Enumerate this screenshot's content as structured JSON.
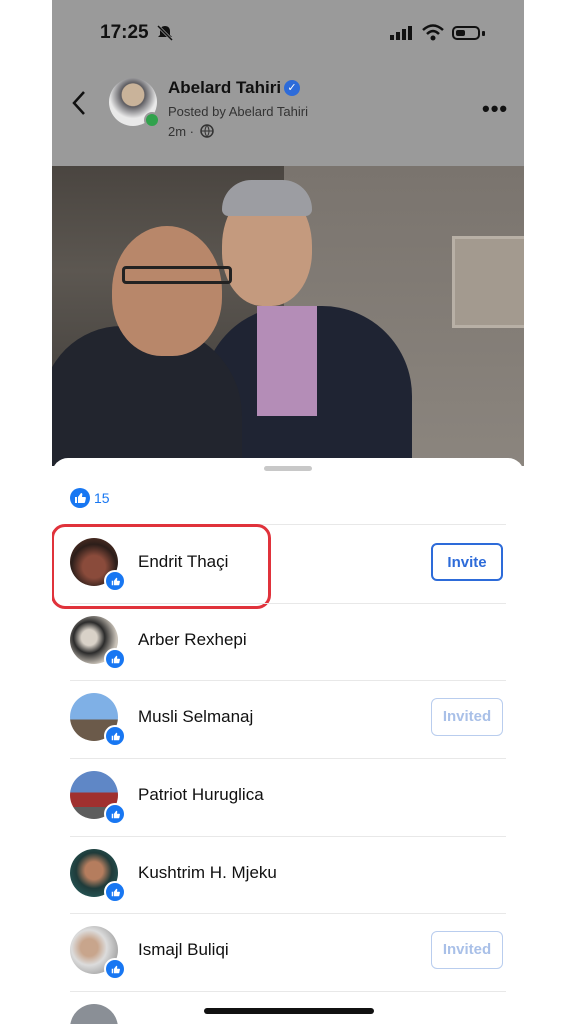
{
  "status_bar": {
    "time": "17:25"
  },
  "post_header": {
    "author": "Abelard Tahiri",
    "posted_by": "Posted by Abelard Tahiri",
    "age": "2m ·"
  },
  "reactions": {
    "count": "15",
    "rows": [
      {
        "name": "Endrit Thaçi",
        "action": "Invite",
        "state": "invite",
        "highlighted": true
      },
      {
        "name": "Arber Rexhepi",
        "action": "",
        "state": "none"
      },
      {
        "name": "Musli Selmanaj",
        "action": "Invited",
        "state": "invited"
      },
      {
        "name": "Patriot Huruglica",
        "action": "",
        "state": "none"
      },
      {
        "name": "Kushtrim H. Mjeku",
        "action": "",
        "state": "none"
      },
      {
        "name": "Ismajl Buliqi",
        "action": "Invited",
        "state": "invited"
      }
    ]
  },
  "colors": {
    "accent": "#1877f2",
    "highlight": "#e0323b",
    "overlay": "#9a9a9a"
  }
}
